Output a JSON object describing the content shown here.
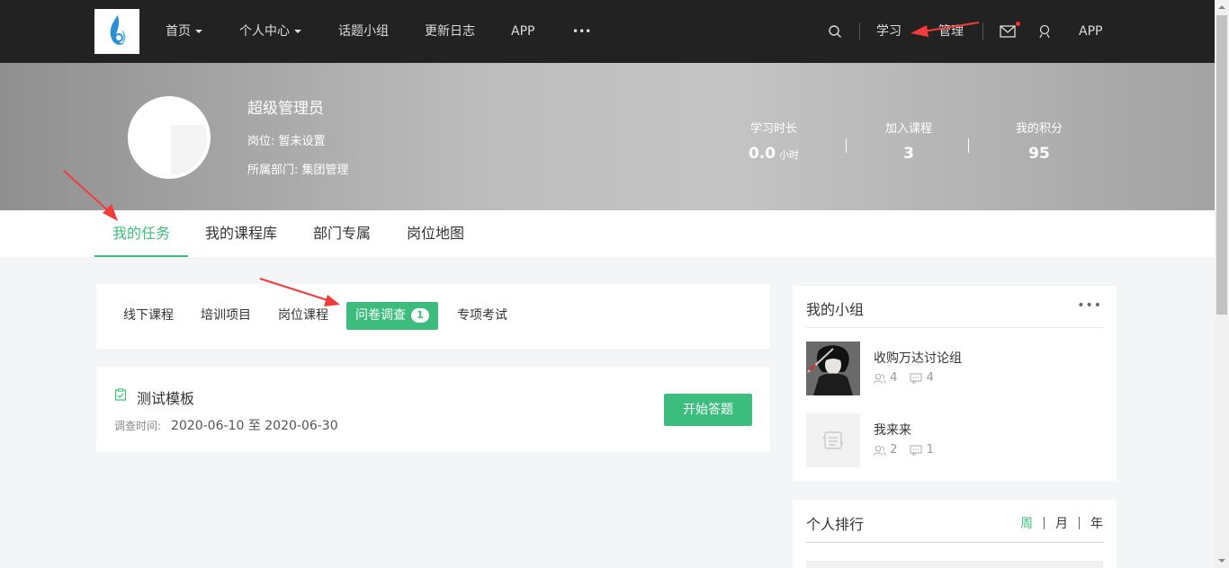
{
  "nav": {
    "items": [
      "首页",
      "个人中心",
      "话题小组",
      "更新日志",
      "APP",
      "•••"
    ],
    "right": {
      "study": "学习",
      "manage": "管理",
      "app": "APP"
    }
  },
  "profile": {
    "name": "超级管理员",
    "position": "岗位: 暂未设置",
    "department": "所属部门: 集团管理",
    "stats": [
      {
        "label": "学习时长",
        "value": "0.0",
        "unit": "小时"
      },
      {
        "label": "加入课程",
        "value": "3",
        "unit": ""
      },
      {
        "label": "我的积分",
        "value": "95",
        "unit": ""
      }
    ]
  },
  "tabs": [
    "我的任务",
    "我的课程库",
    "部门专属",
    "岗位地图"
  ],
  "subtabs": [
    "线下课程",
    "培训项目",
    "岗位课程",
    "问卷调查",
    "专项考试"
  ],
  "subtab_badge": "1",
  "survey": {
    "title": "测试模板",
    "time_label": "调查时间:",
    "time_range": "2020-06-10 至 2020-06-30",
    "button": "开始答题"
  },
  "groups": {
    "title": "我的小组",
    "more": "•••",
    "items": [
      {
        "name": "收购万达讨论组",
        "members": "4",
        "topics": "4"
      },
      {
        "name": "我来来",
        "members": "2",
        "topics": "1"
      }
    ]
  },
  "ranking": {
    "title": "个人排行",
    "periods": [
      "周",
      "月",
      "年"
    ]
  },
  "colors": {
    "accent": "#3dbd7d",
    "nav_bg": "#222222",
    "annotation": "#f23c3c"
  }
}
